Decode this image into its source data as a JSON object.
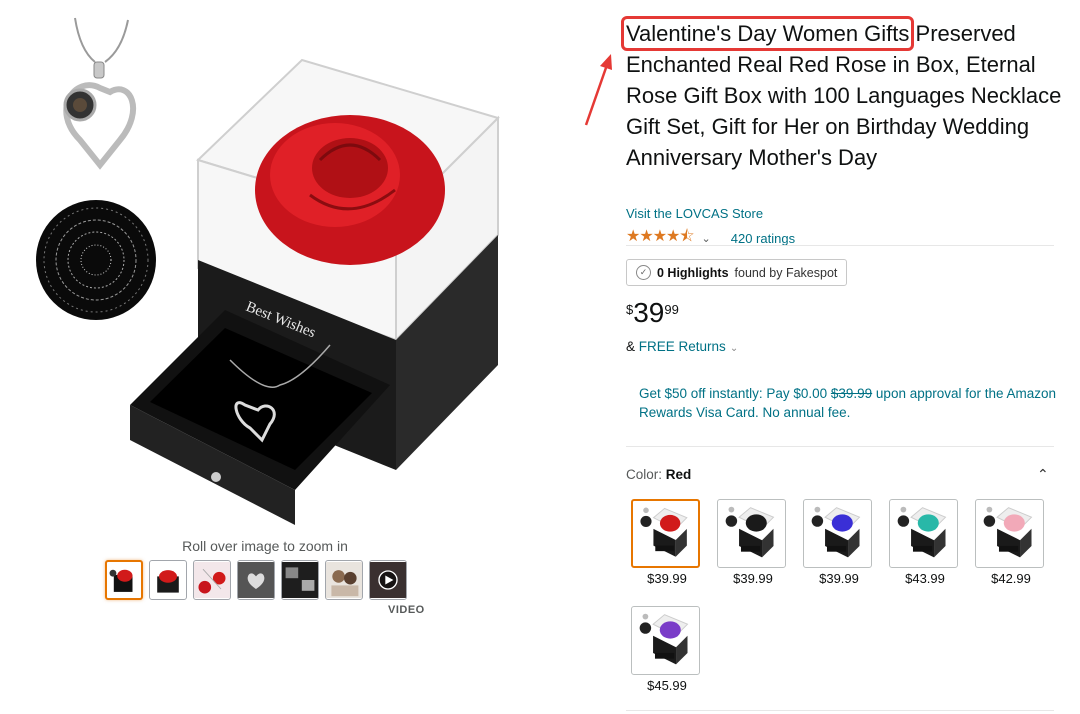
{
  "product": {
    "title_highlighted": "Valentine's Day Women Gifts",
    "title_rest": "Preserved Enchanted Real Red Rose in Box, Eternal Rose Gift Box with 100 Languages Necklace Gift Set, Gift for Her on Birthday Wedding Anniversary Mother's Day",
    "store_link": "Visit the LOVCAS Store",
    "rating_stars": "★★★★⯪",
    "rating_value": 4.5,
    "ratings_count": "420 ratings",
    "box_lid_text": "Best Wishes"
  },
  "fakespot": {
    "count": "0 Highlights",
    "suffix": "found by Fakespot"
  },
  "price": {
    "symbol": "$",
    "whole": "39",
    "fraction": "99"
  },
  "returns": {
    "prefix": "&",
    "link": "FREE Returns"
  },
  "promo": {
    "before": "Get $50 off instantly: Pay $0.00 ",
    "strike": "$39.99",
    "after": " upon approval for the Amazon Rewards Visa Card. No annual fee."
  },
  "gallery": {
    "zoom_hint": "Roll over image to zoom in",
    "video_label": "VIDEO"
  },
  "color": {
    "label": "Color:",
    "selected": "Red",
    "options": [
      {
        "price": "$39.99",
        "rose": "#d11a1a"
      },
      {
        "price": "$39.99",
        "rose": "#1a1a1a"
      },
      {
        "price": "$39.99",
        "rose": "#3a2fd6"
      },
      {
        "price": "$43.99",
        "rose": "#28b8a8"
      },
      {
        "price": "$42.99",
        "rose": "#f2a9b8"
      },
      {
        "price": "$45.99",
        "rose": "#7a3cc8"
      }
    ]
  },
  "colors": {
    "link": "#007185",
    "star": "#de7921",
    "selected_border": "#e77600",
    "annotation": "#e53935"
  }
}
